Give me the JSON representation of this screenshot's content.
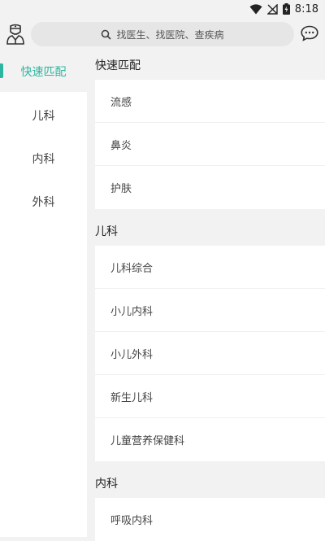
{
  "status_bar": {
    "time": "8:18",
    "wifi_icon": "wifi-icon",
    "signal_icon": "no-signal-icon",
    "battery_icon": "battery-charging-icon"
  },
  "header": {
    "doctor_icon": "doctor-icon",
    "search_placeholder": "找医生、找医院、查疾病",
    "chat_icon": "chat-bubble-icon"
  },
  "sidebar": {
    "accent_color": "#2cb5a0",
    "items": [
      {
        "label": "快速匹配",
        "active": true
      },
      {
        "label": "儿科",
        "active": false
      },
      {
        "label": "内科",
        "active": false
      },
      {
        "label": "外科",
        "active": false
      }
    ]
  },
  "sections": [
    {
      "title": "快速匹配",
      "items": [
        "流感",
        "鼻炎",
        "护肤"
      ]
    },
    {
      "title": "儿科",
      "items": [
        "儿科综合",
        "小儿内科",
        "小儿外科",
        "新生儿科",
        "儿童营养保健科"
      ]
    },
    {
      "title": "内科",
      "items": [
        "呼吸内科"
      ]
    }
  ]
}
